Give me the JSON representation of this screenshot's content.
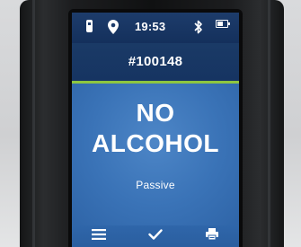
{
  "status_bar": {
    "time": "19:53",
    "icons": [
      "device-icon",
      "location-icon",
      "bluetooth-icon",
      "battery-icon"
    ],
    "battery_level": 0.6
  },
  "header": {
    "test_id": "#100148"
  },
  "result": {
    "line1": "NO",
    "line2": "ALCOHOL",
    "mode": "Passive"
  },
  "softkeys": {
    "icons": [
      "menu-icon",
      "checkmark-icon",
      "printer-icon"
    ]
  },
  "colors": {
    "status_bar": "#1d3c6b",
    "header": "#1a3a66",
    "divider": "#8ec63f",
    "result_bg": "#3a73b7",
    "softkey_bar": "#2f66aa",
    "device_body": "#141516"
  }
}
